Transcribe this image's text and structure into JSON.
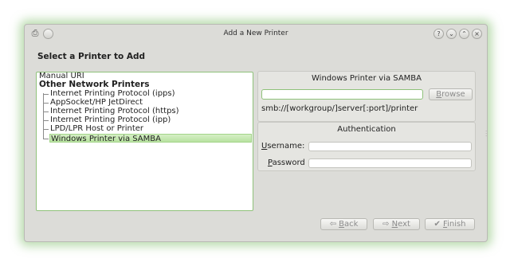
{
  "window": {
    "title": "Add a New Printer",
    "heading": "Select a Printer to Add"
  },
  "titlebar_buttons": {
    "help": "?",
    "shade": "⌄",
    "maximize": "⌃",
    "close": "×"
  },
  "tree": {
    "manual": "Manual URI",
    "group": "Other Network Printers",
    "children": [
      "Internet Printing Protocol (ipps)",
      "AppSocket/HP JetDirect",
      "Internet Printing Protocol (https)",
      "Internet Printing Protocol (ipp)",
      "LPD/LPR Host or Printer",
      "Windows Printer via SAMBA"
    ],
    "selected_index": 5
  },
  "panel": {
    "title": "Windows Printer via SAMBA",
    "uri_value": "",
    "browse_label_pre": "B",
    "browse_label_rest": "rowse",
    "uri_hint": "smb://[workgroup/]server[:port]/printer"
  },
  "auth": {
    "title": "Authentication",
    "username_pre": "U",
    "username_rest": "sername:",
    "password_pre": "P",
    "password_rest": "assword",
    "username_value": "",
    "password_value": ""
  },
  "footer": {
    "back_pre": "B",
    "back_rest": "ack",
    "next_pre": "N",
    "next_rest": "ext",
    "finish_pre": "F",
    "finish_rest": "inish"
  },
  "colors": {
    "selection": "#b8e2a1",
    "focus_border": "#8fc27a",
    "window_bg": "#dcdcd8"
  },
  "icons": {
    "app": "printer-icon",
    "back": "arrow-left-icon",
    "next": "arrow-right-icon",
    "finish": "checkmark-icon"
  }
}
